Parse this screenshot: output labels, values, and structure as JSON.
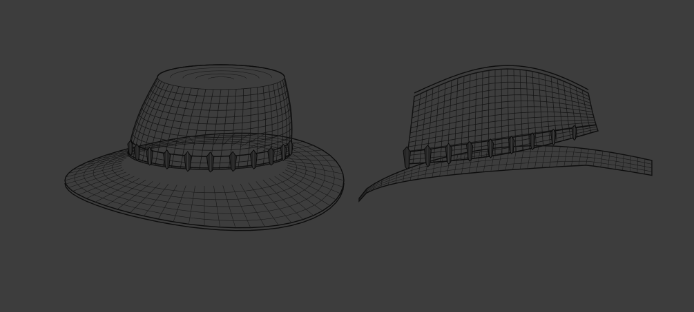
{
  "scene": {
    "background_color": "#3d3d3d",
    "wire_color": "#141414",
    "objects": [
      {
        "name": "hat-front-view",
        "teeth": 11
      },
      {
        "name": "hat-side-view",
        "teeth": 9
      }
    ]
  }
}
